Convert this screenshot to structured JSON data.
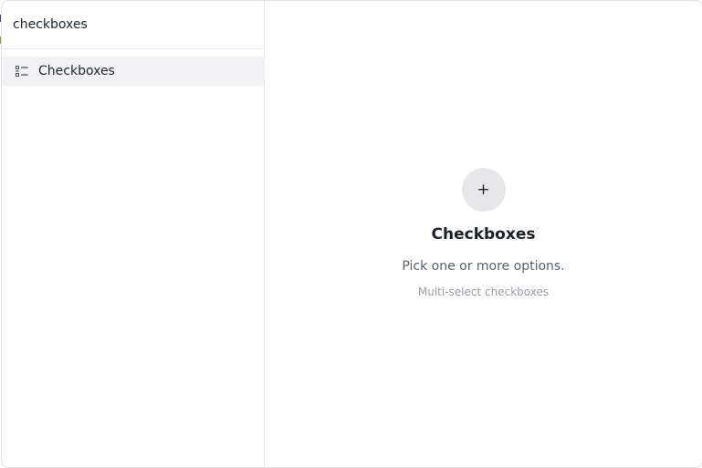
{
  "search": {
    "value": "checkboxes"
  },
  "sidebar": {
    "items": [
      {
        "label": "Checkboxes",
        "icon": "list-checks-icon",
        "selected": true
      }
    ]
  },
  "main": {
    "add_icon": "+",
    "title": "Checkboxes",
    "description": "Pick one or more options.",
    "hint": "Multi-select checkboxes"
  },
  "colors": {
    "selected_bg": "#f2f2f4",
    "add_button_bg": "#e7e7ea",
    "text_primary": "#1f2430",
    "text_secondary": "#5b6170",
    "text_muted": "#9a9ea8"
  }
}
